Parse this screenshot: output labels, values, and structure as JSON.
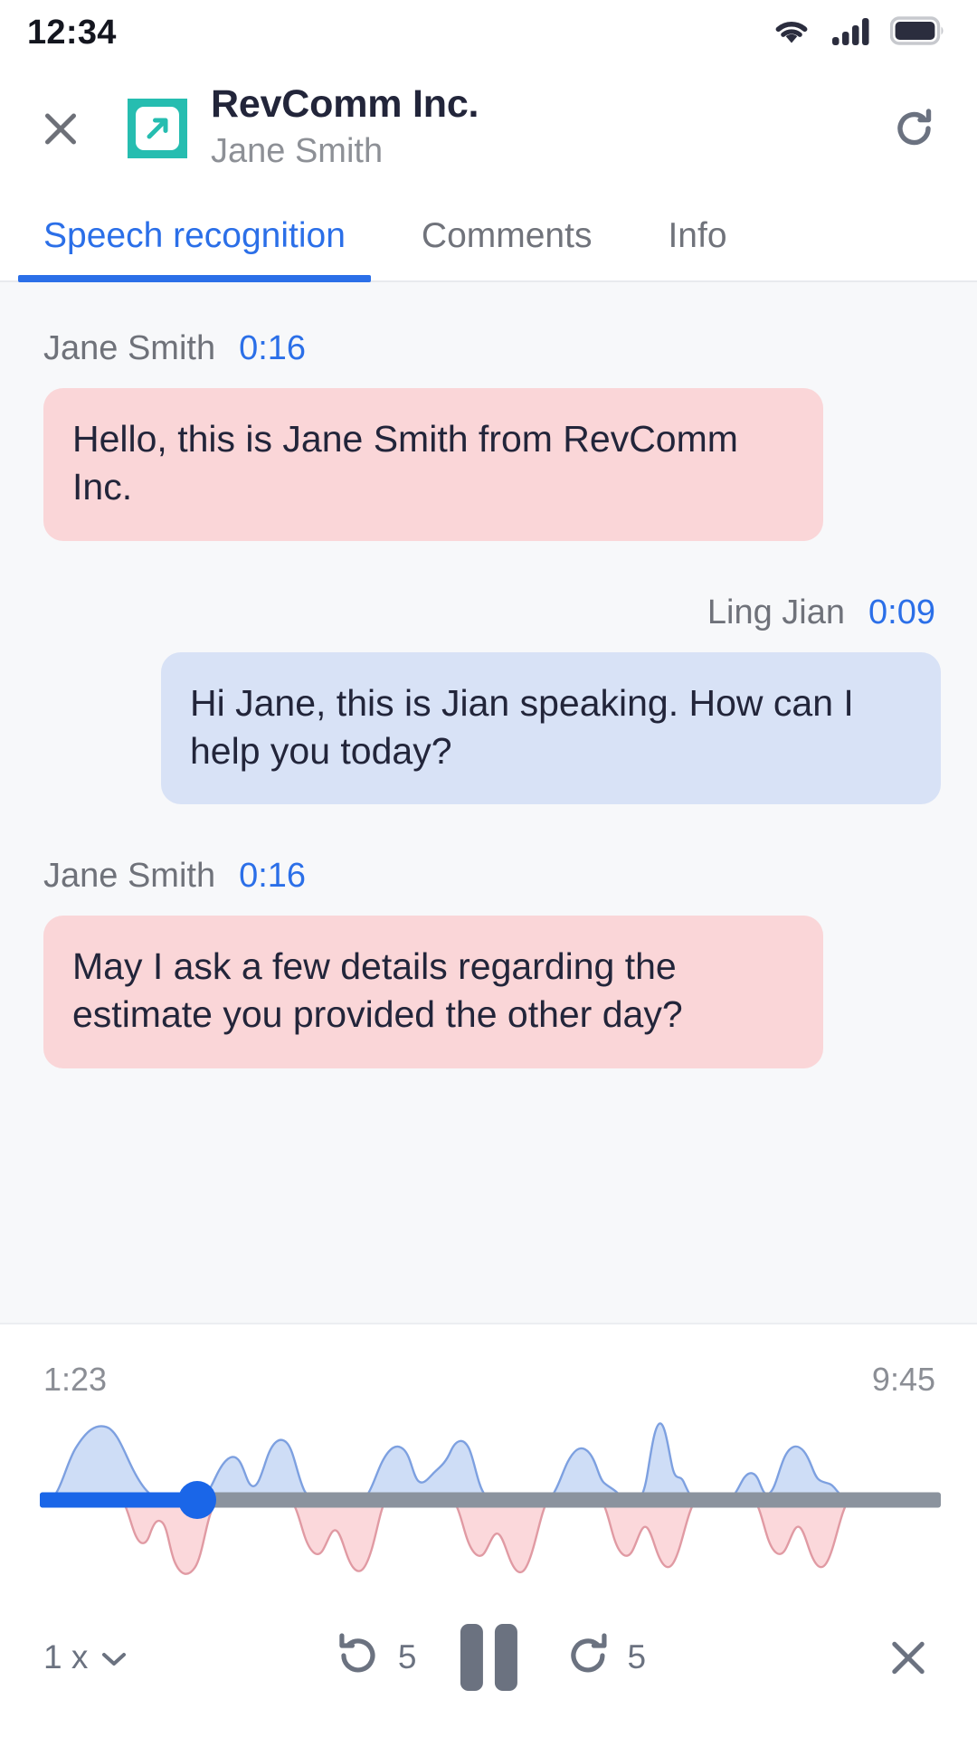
{
  "status_bar": {
    "time": "12:34",
    "wifi_icon": "wifi-icon",
    "cellular_icon": "cellular-signal-icon",
    "battery_icon": "battery-full-icon"
  },
  "header": {
    "close_icon": "close-icon",
    "logo_icon": "revcomm-arrow-logo-icon",
    "title": "RevComm Inc.",
    "subtitle": "Jane Smith",
    "refresh_icon": "refresh-icon"
  },
  "tabs": [
    {
      "label": "Speech recognition",
      "active": true
    },
    {
      "label": "Comments",
      "active": false
    },
    {
      "label": "Info",
      "active": false
    }
  ],
  "transcript": {
    "messages": [
      {
        "speaker": "Jane Smith",
        "time": "0:16",
        "text": "Hello, this is Jane Smith from RevComm Inc.",
        "side": "left",
        "bubble_color": "#fad6d8"
      },
      {
        "speaker": "Ling Jian",
        "time": "0:09",
        "text": "Hi Jane, this is Jian speaking. How can I help you today?",
        "side": "right",
        "bubble_color": "#d8e2f6"
      },
      {
        "speaker": "Jane Smith",
        "time": "0:16",
        "text": "May I ask a few details regarding the estimate you provided the other day?",
        "side": "left",
        "bubble_color": "#fad6d8"
      }
    ]
  },
  "player": {
    "current_time": "1:23",
    "total_time": "9:45",
    "progress_percent": 17.5,
    "speed_label": "1 x",
    "speed_chevron_icon": "chevron-down-icon",
    "rewind_icon": "rewind-5-icon",
    "rewind_seconds": "5",
    "pause_icon": "pause-icon",
    "forward_icon": "forward-5-icon",
    "forward_seconds": "5",
    "close_icon": "close-icon"
  },
  "colors": {
    "accent_blue": "#2b6fe8",
    "brand_teal": "#26bdb0",
    "bubble_pink": "#fad6d8",
    "bubble_blue": "#d8e2f6",
    "track_gray": "#8b939e",
    "transcript_bg": "#f7f8fa"
  }
}
